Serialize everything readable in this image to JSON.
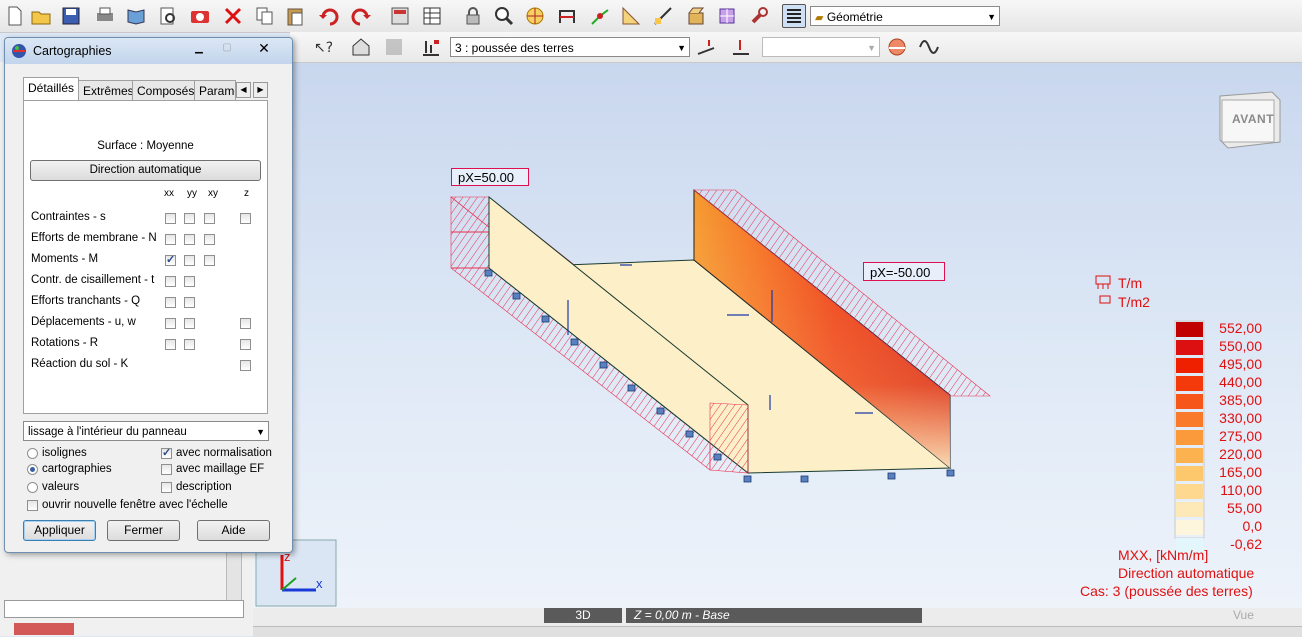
{
  "toolbar": {
    "load_case_combo": "3 : poussée des terres",
    "geometry_combo": "Géométrie",
    "empty_combo": ""
  },
  "dialog": {
    "title": "Cartographies",
    "tabs": [
      "Détaillés",
      "Extrêmes",
      "Composés",
      "Paramè"
    ],
    "surface_label": "Surface : Moyenne",
    "direction_button": "Direction automatique",
    "col_headers": [
      "xx",
      "yy",
      "xy",
      "z"
    ],
    "rows": [
      {
        "label": "Contraintes - s",
        "xx": false,
        "yy": false,
        "xy": false,
        "z": false
      },
      {
        "label": "Efforts de membrane - N",
        "xx": false,
        "yy": false,
        "xy": false
      },
      {
        "label": "Moments - M",
        "xx": true,
        "yy": false,
        "xy": false
      },
      {
        "label": "Contr. de cisaillement - t",
        "xx": false,
        "yy": false
      },
      {
        "label": "Efforts tranchants - Q",
        "xx": false,
        "yy": false
      },
      {
        "label": "Déplacements - u, w",
        "xx": false,
        "yy": false,
        "z": false
      },
      {
        "label": "Rotations - R",
        "xx": false,
        "yy": false,
        "z": false
      },
      {
        "label": "Réaction du sol - K",
        "z": false
      }
    ],
    "smoothing_combo": "lissage à l'intérieur du panneau",
    "radios": [
      "isolignes",
      "cartographies",
      "valeurs"
    ],
    "selected_radio": "cartographies",
    "options": [
      {
        "label": "avec normalisation",
        "checked": true
      },
      {
        "label": "avec maillage EF",
        "checked": false
      },
      {
        "label": "description",
        "checked": false
      }
    ],
    "new_window_label": "ouvrir nouvelle fenêtre avec l'échelle",
    "buttons": {
      "apply": "Appliquer",
      "close": "Fermer",
      "help": "Aide"
    }
  },
  "viewport": {
    "nav_cube_label": "AVANT",
    "load_label_1": "pX=50.00",
    "load_label_2": "pX=-50.00",
    "unit_1": "T/m",
    "unit_2": "T/m2",
    "axis_x": "x",
    "axis_z": "z"
  },
  "legend": {
    "values": [
      "552,00",
      "550,00",
      "495,00",
      "440,00",
      "385,00",
      "330,00",
      "275,00",
      "220,00",
      "165,00",
      "110,00",
      "55,00",
      "0,0",
      "-0,62"
    ],
    "colors": [
      "#c00000",
      "#dc1010",
      "#ee2000",
      "#f43a0a",
      "#f6561a",
      "#f87a2a",
      "#fa9a3a",
      "#fcb24e",
      "#fdc76c",
      "#fed88e",
      "#fde9b8",
      "#fdf6dc",
      "#e2f6fb"
    ],
    "title": "MXX, [kNm/m]",
    "subtitle": "Direction automatique",
    "case": "Cas: 3 (poussée des terres)"
  },
  "status": {
    "mode": "3D",
    "plane": "Z = 0,00 m - Base",
    "view": "Vue"
  },
  "colors": {
    "hatch": "#e83050",
    "accent": "#e01010",
    "slab": "#fdf0c8"
  }
}
